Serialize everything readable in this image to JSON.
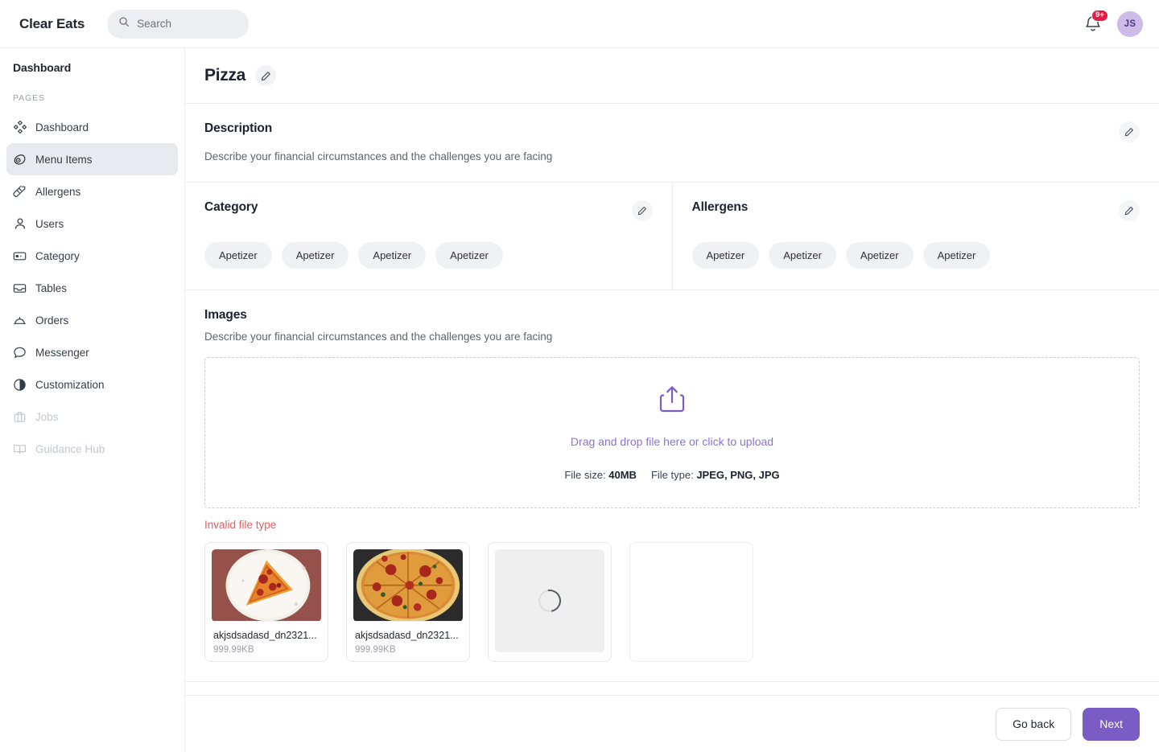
{
  "topbar": {
    "brand": "Clear Eats",
    "search_placeholder": "Search",
    "notification_badge": "9+",
    "avatar_initials": "JS"
  },
  "sidebar": {
    "title": "Dashboard",
    "section_label": "PAGES",
    "items": [
      {
        "label": "Dashboard",
        "icon": "grid-diamond-icon",
        "active": false,
        "disabled": false
      },
      {
        "label": "Menu Items",
        "icon": "meat-icon",
        "active": true,
        "disabled": false
      },
      {
        "label": "Allergens",
        "icon": "carrot-icon",
        "active": false,
        "disabled": false
      },
      {
        "label": "Users",
        "icon": "user-icon",
        "active": false,
        "disabled": false
      },
      {
        "label": "Category",
        "icon": "card-icon",
        "active": false,
        "disabled": false
      },
      {
        "label": "Tables",
        "icon": "tray-icon",
        "active": false,
        "disabled": false
      },
      {
        "label": "Orders",
        "icon": "cloche-icon",
        "active": false,
        "disabled": false
      },
      {
        "label": "Messenger",
        "icon": "chat-bubble-icon",
        "active": false,
        "disabled": false
      },
      {
        "label": "Customization",
        "icon": "contrast-circle-icon",
        "active": false,
        "disabled": false
      },
      {
        "label": "Jobs",
        "icon": "briefcase-icon",
        "active": false,
        "disabled": true
      },
      {
        "label": "Guidance Hub",
        "icon": "book-open-icon",
        "active": false,
        "disabled": true
      }
    ]
  },
  "page": {
    "title": "Pizza"
  },
  "description": {
    "title": "Description",
    "text": "Describe your financial circumstances and the challenges you are facing"
  },
  "category": {
    "title": "Category",
    "chips": [
      "Apetizer",
      "Apetizer",
      "Apetizer",
      "Apetizer"
    ]
  },
  "allergens": {
    "title": "Allergens",
    "chips": [
      "Apetizer",
      "Apetizer",
      "Apetizer",
      "Apetizer"
    ]
  },
  "images": {
    "title": "Images",
    "subtitle": "Describe your financial circumstances and the challenges you are facing",
    "dropzone_link": "Drag and drop file here or click to upload",
    "file_size_label": "File size:",
    "file_size_value": "40MB",
    "file_type_label": "File type:",
    "file_type_value": "JPEG, PNG, JPG",
    "error": "Invalid file type",
    "thumbs": [
      {
        "state": "image",
        "name": "akjsdsadasd_dn2321...",
        "size": "999.99KB"
      },
      {
        "state": "image",
        "name": "akjsdsadasd_dn2321...",
        "size": "999.99KB"
      },
      {
        "state": "loading",
        "name": "",
        "size": ""
      },
      {
        "state": "empty",
        "name": "",
        "size": ""
      }
    ]
  },
  "footer": {
    "back_label": "Go back",
    "next_label": "Next"
  },
  "colors": {
    "accent_purple": "#7b5bc4",
    "link_purple": "#8b72cf",
    "error_red": "#e0615f",
    "badge_red": "#e11d48",
    "avatar_bg": "#cdbbe8",
    "sidebar_active_bg": "#e7eaef"
  }
}
